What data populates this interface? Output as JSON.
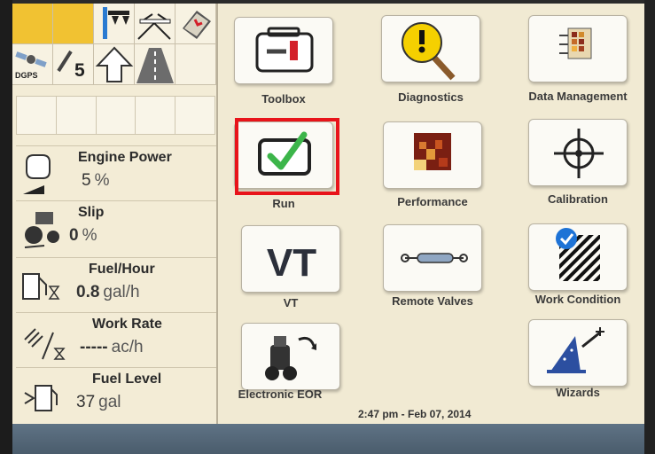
{
  "status": {
    "gps_label": "DGPS",
    "gear_number": "5"
  },
  "readouts": [
    {
      "title": "Engine Power",
      "value": "5",
      "unit": "%"
    },
    {
      "title": "Slip",
      "value": "0",
      "unit": "%"
    },
    {
      "title": "Fuel/Hour",
      "value": "0.8",
      "unit": "gal/h"
    },
    {
      "title": "Work Rate",
      "value": "-----",
      "unit": "ac/h"
    },
    {
      "title": "Fuel Level",
      "value": "37",
      "unit": "gal"
    }
  ],
  "apps": [
    {
      "label": "Toolbox",
      "icon": "toolbox-icon"
    },
    {
      "label": "Diagnostics",
      "icon": "diagnostics-icon"
    },
    {
      "label": "Data Management",
      "icon": "data-management-icon"
    },
    {
      "label": "Run",
      "icon": "run-checkmark-icon",
      "highlighted": true
    },
    {
      "label": "Performance",
      "icon": "performance-icon"
    },
    {
      "label": "Calibration",
      "icon": "calibration-icon"
    },
    {
      "label": "VT",
      "icon": "vt-icon"
    },
    {
      "label": "Remote Valves",
      "icon": "remote-valves-icon"
    },
    {
      "label": "Work Condition",
      "icon": "work-condition-icon"
    },
    {
      "label": "Electronic EOR",
      "icon": "electronic-eor-icon"
    },
    {
      "label": "Wizards",
      "icon": "wizard-hat-icon"
    }
  ],
  "vt_glyph": "VT",
  "datetime": "2:47 pm - Feb 07, 2014",
  "colors": {
    "screen_bg": "#f1ead3",
    "status_yellow": "#f1c232",
    "highlight_red": "#e8141a",
    "check_green": "#3cb54a",
    "bottom_bar": "#546878"
  }
}
